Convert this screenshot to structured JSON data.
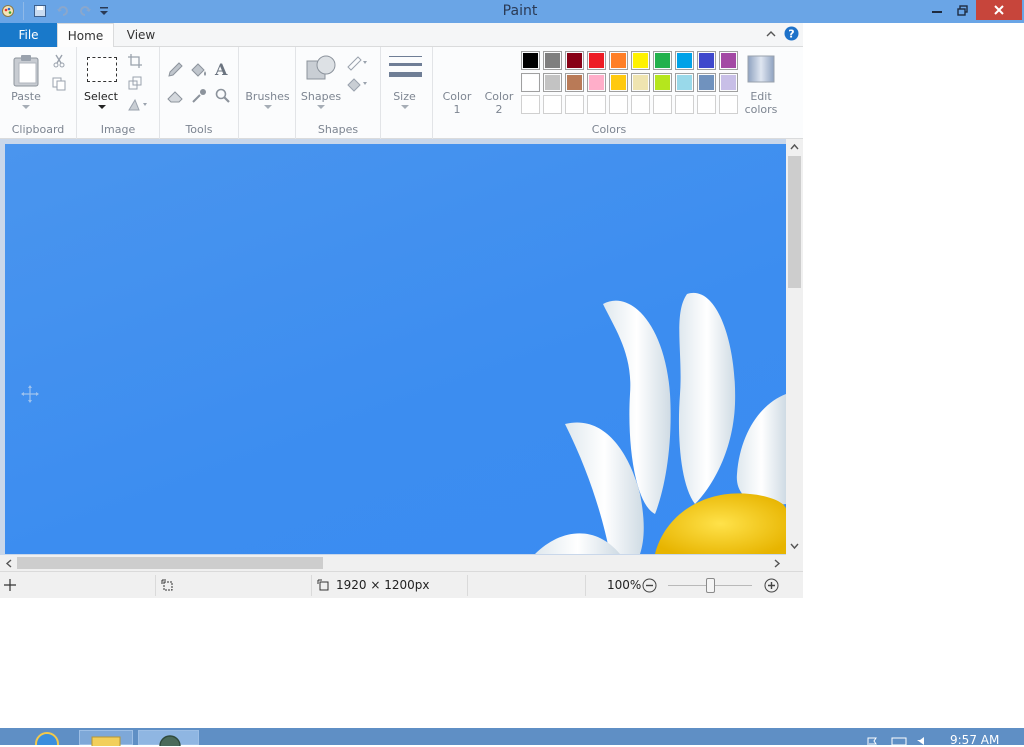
{
  "window": {
    "title": "Paint"
  },
  "tabs": {
    "file": "File",
    "home": "Home",
    "view": "View"
  },
  "ribbon": {
    "clipboard": {
      "label": "Clipboard",
      "paste": "Paste"
    },
    "image": {
      "label": "Image",
      "select": "Select"
    },
    "tools": {
      "label": "Tools"
    },
    "brushes": {
      "label": "Brushes"
    },
    "shapes": {
      "label": "Shapes",
      "shapes_button": "Shapes"
    },
    "size": {
      "label": "Size"
    },
    "colors": {
      "label": "Colors",
      "color1": "Color",
      "color1_num": "1",
      "color2": "Color",
      "color2_num": "2",
      "edit": "Edit",
      "edit2": "colors",
      "row1": [
        "#000000",
        "#7f7f7f",
        "#880015",
        "#ed1c24",
        "#ff7f27",
        "#fff200",
        "#22b14c",
        "#00a2e8",
        "#3f48cc",
        "#a349a4"
      ],
      "row2": [
        "#ffffff",
        "#c3c3c3",
        "#b97a57",
        "#ffaec9",
        "#ffc90e",
        "#efe4b0",
        "#b5e61d",
        "#99d9ea",
        "#7092be",
        "#c8bfe7"
      ]
    }
  },
  "status": {
    "dimensions": "1920 × 1200px",
    "zoom": "100%"
  },
  "taskbar": {
    "clock": "9:57 AM"
  }
}
